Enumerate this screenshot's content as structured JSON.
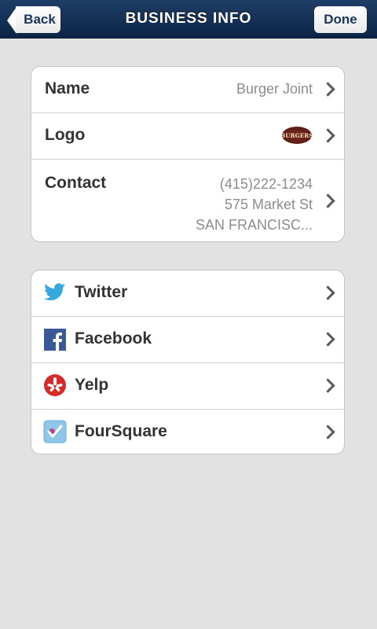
{
  "header": {
    "title": "BUSINESS INFO",
    "back_label": "Back",
    "done_label": "Done"
  },
  "business": {
    "name_label": "Name",
    "name_value": "Burger Joint",
    "logo_label": "Logo",
    "logo_text": "BURGERS",
    "contact_label": "Contact",
    "contact_phone": "(415)222-1234",
    "contact_street": "575 Market St",
    "contact_city": "SAN FRANCISC..."
  },
  "social": {
    "items": [
      {
        "label": "Twitter",
        "icon": "twitter-icon"
      },
      {
        "label": "Facebook",
        "icon": "facebook-icon"
      },
      {
        "label": "Yelp",
        "icon": "yelp-icon"
      },
      {
        "label": "FourSquare",
        "icon": "foursquare-icon"
      }
    ]
  },
  "colors": {
    "navbar": "#0b2445",
    "background": "#e2e2e2",
    "twitter": "#35a8dd",
    "facebook": "#3b5998",
    "yelp": "#d52b2b",
    "foursquare": "#8ec7e8"
  }
}
